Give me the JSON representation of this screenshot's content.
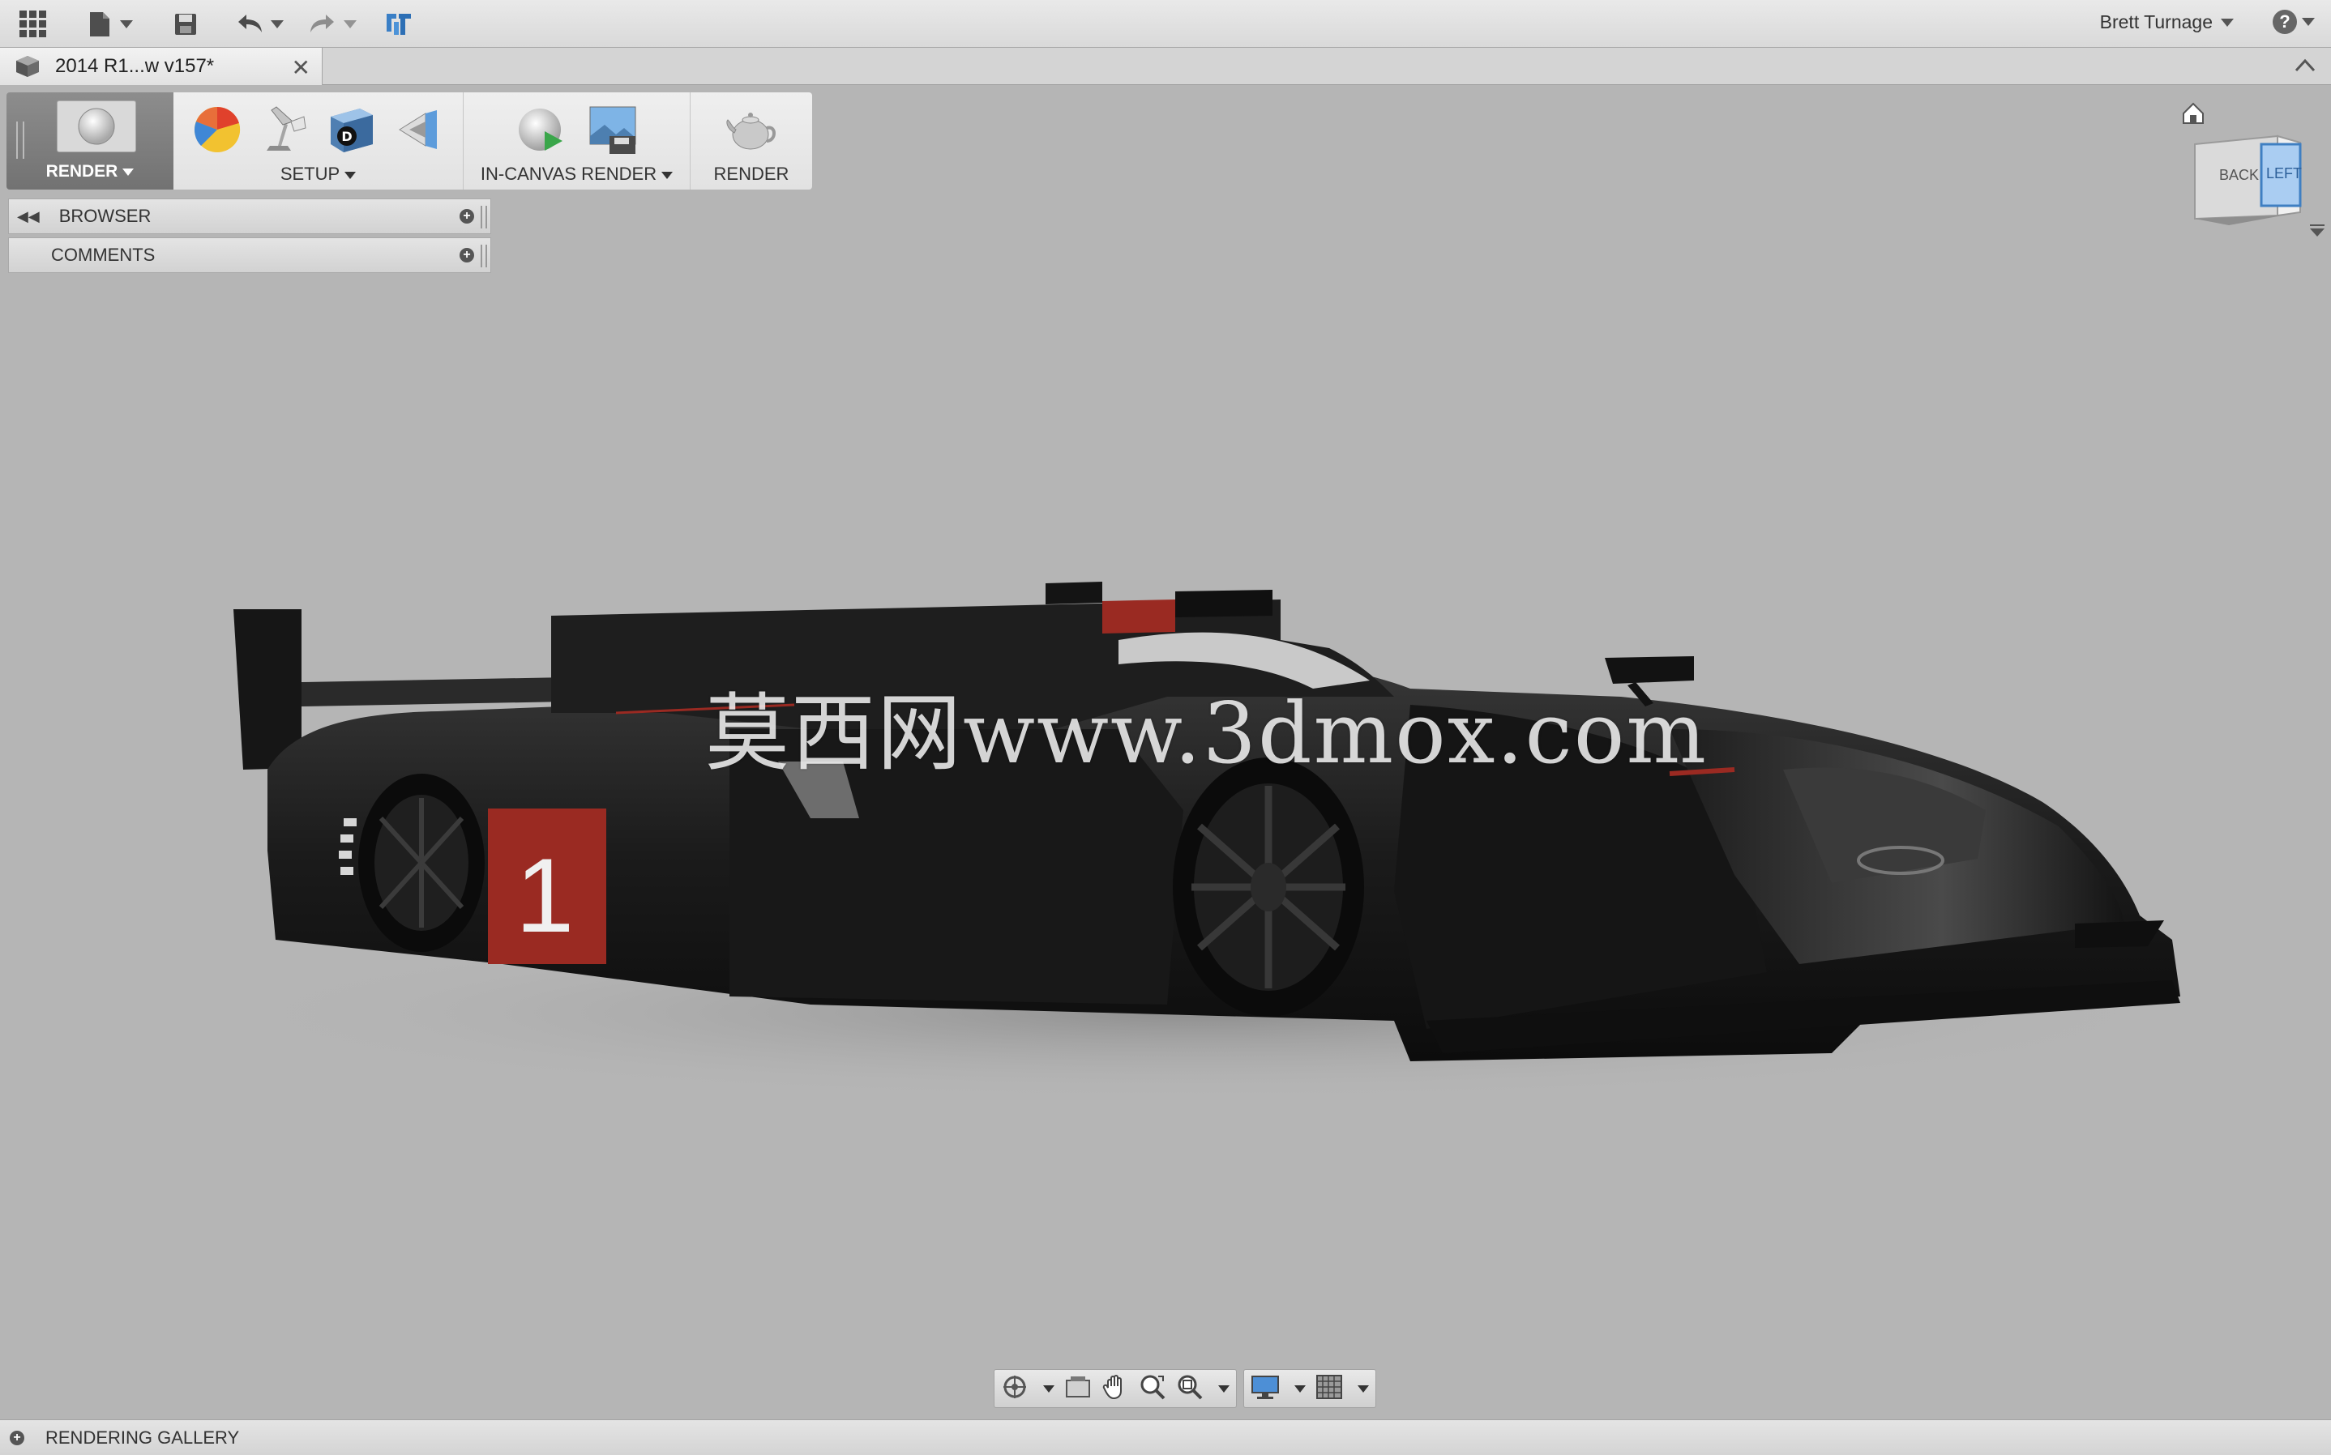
{
  "app": {
    "user_name": "Brett Turnage",
    "help_symbol": "?"
  },
  "tab": {
    "title": "2014 R1...w v157*",
    "close_symbol": "✕"
  },
  "toolbar": {
    "workspace_label": "RENDER",
    "setup_label": "SETUP",
    "in_canvas_label": "IN-CANVAS RENDER",
    "render_label": "RENDER"
  },
  "panels": {
    "browser_label": "BROWSER",
    "comments_label": "COMMENTS"
  },
  "viewcube": {
    "back_label": "BACK",
    "left_label": "LEFT"
  },
  "scene": {
    "car_number": "1",
    "watermark": "莫西网www.3dmox.com"
  },
  "gallery": {
    "label": "RENDERING GALLERY"
  },
  "icons": [
    "grid-icon",
    "file-icon",
    "save-icon",
    "undo-icon",
    "redo-icon",
    "data-panel-icon",
    "home-icon"
  ],
  "colors": {
    "viewport_bg": "#b5b5b5",
    "car_body": "#1a1a1a",
    "accent_red": "#9a2a22",
    "workspace_dark": "#7e7e7e"
  }
}
